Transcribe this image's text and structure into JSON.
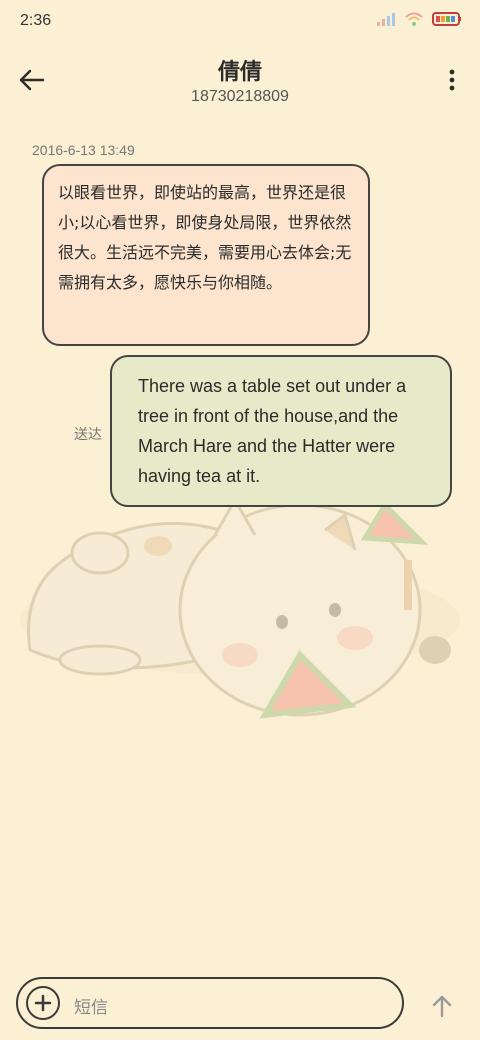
{
  "status_bar": {
    "time": "2:36",
    "signal_icon": "signal-icon",
    "wifi_icon": "wifi-icon",
    "battery_icon": "battery-icon"
  },
  "header": {
    "title": "倩倩",
    "subtitle": "18730218809",
    "back_icon": "back-arrow-icon",
    "more_icon": "more-vert-icon"
  },
  "messages": [
    {
      "timestamp": "2016-6-13 13:49",
      "text": "以眼看世界，即使站的最高，世界还是很小;以心看世界，即使身处局限，世界依然很大。生活远不完美，需要用心去体会;无需拥有太多，愿快乐与你相随。"
    },
    {
      "text": "There was a table set out under a tree in front of the house,and the March Hare and the Hatter were having tea at it.",
      "status": "送达"
    }
  ],
  "composer": {
    "placeholder": "短信",
    "add_icon": "add-circle-icon",
    "send_icon": "send-arrow-icon"
  },
  "colors": {
    "background": "#fbf0d4",
    "incoming_bubble": "#fde4cf",
    "outgoing_bubble": "#e6eac8",
    "border": "#444444"
  }
}
